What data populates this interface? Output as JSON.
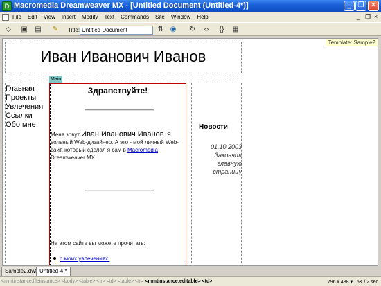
{
  "window": {
    "title": "Macromedia Dreamweaver MX - [Untitled Document (Untitled-4*)]",
    "buttons": [
      "minimize-icon",
      "restore-icon",
      "close-icon"
    ]
  },
  "menu": {
    "items": [
      "File",
      "Edit",
      "View",
      "Insert",
      "Modify",
      "Text",
      "Commands",
      "Site",
      "Window",
      "Help"
    ]
  },
  "toolbar": {
    "title_label": "Title:",
    "title_value": "Untitled Document",
    "icons": [
      "code-view-icon",
      "split-view-icon",
      "design-view-icon",
      "file-management-icon",
      "preview-icon",
      "refresh-icon",
      "reference-icon",
      "code-nav-icon",
      "view-options-icon"
    ]
  },
  "template_tag": "Template: Sample2",
  "page": {
    "site_title": "Иван Иванович Иванов",
    "main_label": "Main",
    "nav": [
      "Главная",
      "Проекты",
      "Увлечения",
      "Ссылки",
      "Обо мне"
    ],
    "greeting": "Здравствуйте!",
    "intro_prefix": "Меня зовут ",
    "intro_name": "Иван Иванович Иванов",
    "intro_mid": ". Я вольный Web-дизайнер. А это - мой личный Web-сайт, который сделал я сам в ",
    "intro_link": "Macromedia ",
    "intro_suffix": "Dreamweaver MX.",
    "read_text": "На этом сайте вы можете прочитать:",
    "bullet_link": "о моих увлечениях:",
    "news_title": "Новости",
    "news_lines": [
      "01.10.2003",
      "Закончил",
      "главную",
      "страницу"
    ]
  },
  "tabs": [
    "Sample2.dwt",
    "Untitled-4 *"
  ],
  "status": {
    "tag_path": "<mmtinstance:fileinstance> <body> <table> <tr> <td> <table> <tr>",
    "tag_current": "<mmtinstance:editable>",
    "tag_last": "<td>",
    "window_size": "796 x 488",
    "file_info": "5K / 2 sec"
  }
}
